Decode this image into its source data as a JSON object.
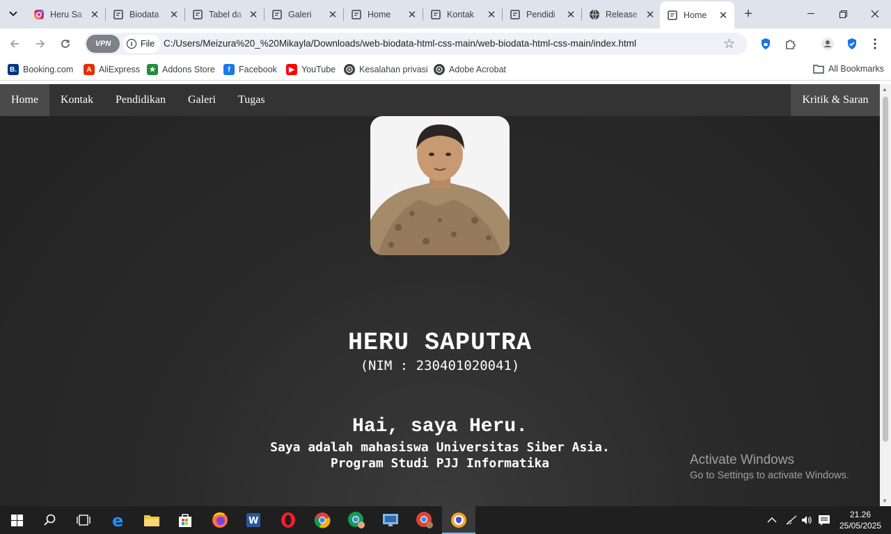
{
  "browser": {
    "tabs": [
      {
        "title": "Heru Sa",
        "icon": "instagram-icon"
      },
      {
        "title": "Biodata",
        "icon": "page-icon"
      },
      {
        "title": "Tabel da",
        "icon": "page-icon"
      },
      {
        "title": "Galeri",
        "icon": "page-icon"
      },
      {
        "title": "Home",
        "icon": "page-icon"
      },
      {
        "title": "Kontak",
        "icon": "page-icon"
      },
      {
        "title": "Pendidi",
        "icon": "page-icon"
      },
      {
        "title": "Release",
        "icon": "globe-icon"
      },
      {
        "title": "Home",
        "icon": "page-icon",
        "active": true
      }
    ],
    "vpn_label": "VPN",
    "scheme_label": "File",
    "url": "C:/Users/Meizura%20_%20Mikayla/Downloads/web-biodata-html-css-main/web-biodata-html-css-main/index.html",
    "bookmarks": [
      {
        "label": "Booking.com",
        "icon": "booking-icon",
        "icon_text": "B.",
        "color": "#003580"
      },
      {
        "label": "AliExpress",
        "icon": "aliexpress-icon",
        "icon_text": "A",
        "color": "#e62e04"
      },
      {
        "label": "Addons Store",
        "icon": "addons-store-icon",
        "icon_text": "★",
        "color": "#1e8e3e"
      },
      {
        "label": "Facebook",
        "icon": "facebook-icon",
        "icon_text": "f",
        "color": "#1877f2"
      },
      {
        "label": "YouTube",
        "icon": "youtube-icon",
        "icon_text": "▶",
        "color": "#ff0000"
      },
      {
        "label": "Kesalahan privasi",
        "icon": "globe-icon",
        "icon_text": "",
        "color": "#3c4043"
      },
      {
        "label": "Adobe Acrobat",
        "icon": "globe-icon",
        "icon_text": "",
        "color": "#3c4043"
      }
    ],
    "all_bookmarks_label": "All Bookmarks"
  },
  "site": {
    "nav": {
      "items": [
        {
          "label": "Home",
          "active": true
        },
        {
          "label": "Kontak"
        },
        {
          "label": "Pendidikan"
        },
        {
          "label": "Galeri"
        },
        {
          "label": "Tugas"
        }
      ],
      "right_label": "Kritik & Saran"
    },
    "profile": {
      "name": "HERU SAPUTRA",
      "nim": "(NIM : 230401020041)",
      "greeting": "Hai, saya Heru.",
      "line1": "Saya adalah mahasiswa Universitas Siber Asia.",
      "line2": "Program Studi PJJ Informatika"
    }
  },
  "watermark": {
    "title": "Activate Windows",
    "subtitle": "Go to Settings to activate Windows."
  },
  "taskbar": {
    "time": "21.26",
    "date": "25/05/2025"
  }
}
